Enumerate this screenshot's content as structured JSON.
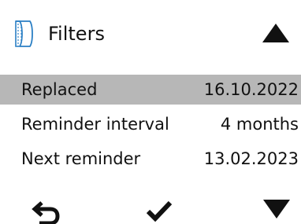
{
  "header": {
    "icon": "filter-icon",
    "title": "Filters",
    "scroll_up_icon": "triangle-up-icon"
  },
  "rows": [
    {
      "label": "Replaced",
      "value": "16.10.2022",
      "selected": true
    },
    {
      "label": "Reminder interval",
      "value": "4 months",
      "selected": false
    },
    {
      "label": "Next reminder",
      "value": "13.02.2023",
      "selected": false
    }
  ],
  "footer": {
    "back_icon": "back-arrow-icon",
    "confirm_icon": "checkmark-icon",
    "scroll_down_icon": "triangle-down-icon"
  },
  "colors": {
    "selected_row": "#b7b7b7",
    "icon_blue": "#2a7fc4",
    "text": "#111111"
  }
}
